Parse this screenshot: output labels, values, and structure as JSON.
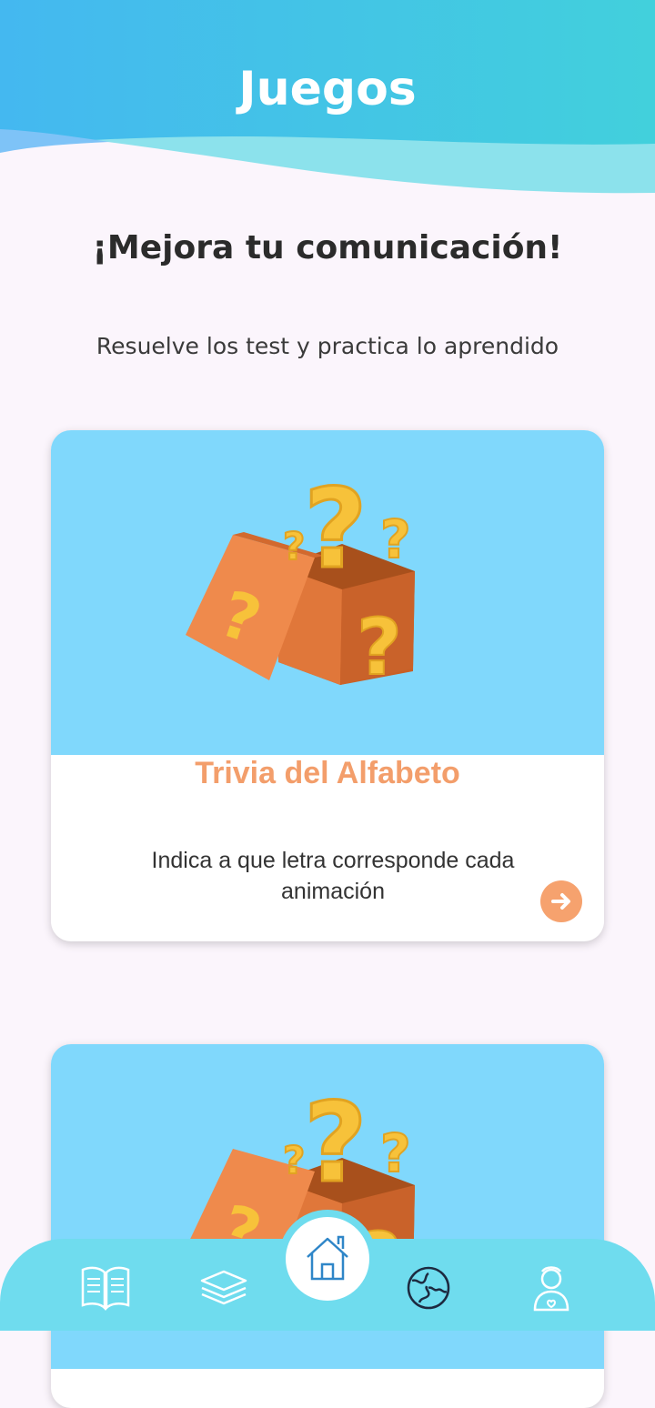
{
  "header": {
    "title": "Juegos"
  },
  "intro": {
    "headline": "¡Mejora tu comunicación!",
    "subtitle": "Resuelve los test y practica lo aprendido"
  },
  "games": [
    {
      "title": "Trivia del Alfabeto",
      "description": "Indica a que letra corresponde cada animación",
      "image_icon": "question-box-icon"
    },
    {
      "image_icon": "question-box-icon"
    }
  ],
  "bottom_nav": {
    "items": [
      {
        "icon": "book-icon"
      },
      {
        "icon": "layers-icon"
      },
      {
        "icon": "home-icon",
        "active": true
      },
      {
        "icon": "puzzle-globe-icon"
      },
      {
        "icon": "profile-icon"
      }
    ]
  },
  "colors": {
    "header_gradient_start": "#44b8f0",
    "header_gradient_end": "#42d0dc",
    "card_image_bg": "#80d8fc",
    "accent_orange": "#f39e6b",
    "nav_bg": "#6fdcee",
    "page_bg": "#fbf5fc"
  }
}
